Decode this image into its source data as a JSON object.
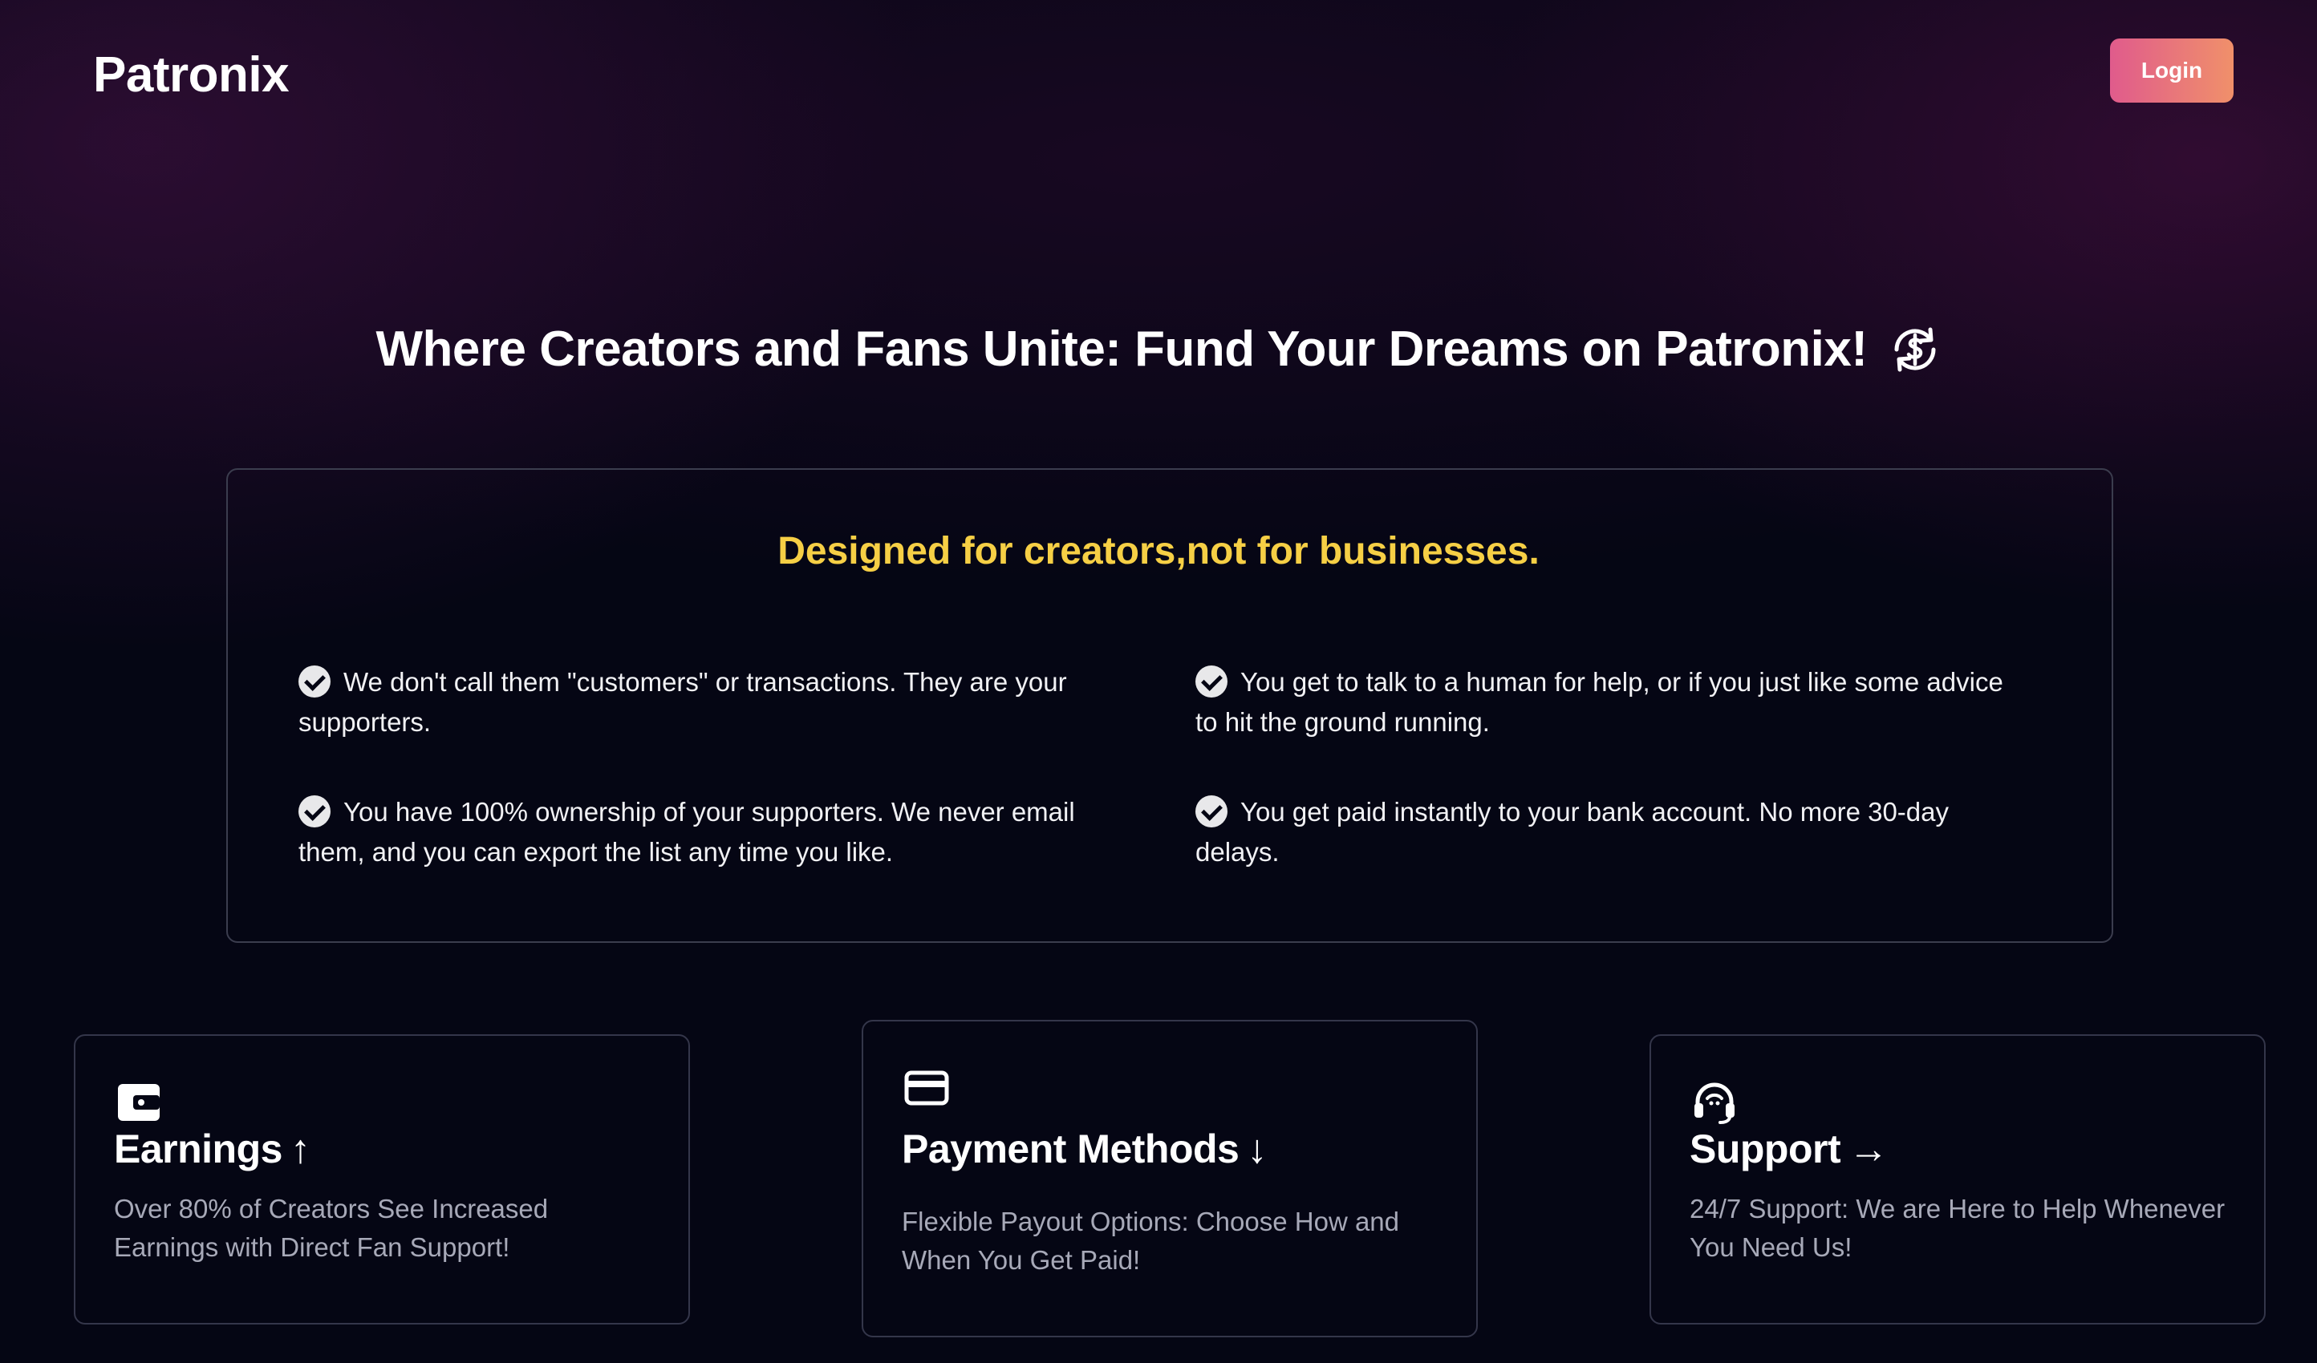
{
  "header": {
    "brand": "Patronix",
    "login_label": "Login"
  },
  "hero": {
    "title": "Where Creators and Fans Unite: Fund Your Dreams on Patronix!",
    "icon": "dollar-refresh-icon"
  },
  "features": {
    "title": "Designed for creators,not for businesses.",
    "accent_color": "#f6cf45",
    "points": [
      {
        "text": "We don't call them \"customers\" or transactions. They are your supporters."
      },
      {
        "text": "You get to talk to a human for help, or if you just like some advice to hit the ground running."
      },
      {
        "text": "You have 100% ownership of your supporters. We never email them, and you can export the list any time you like."
      },
      {
        "text": "You get paid instantly to your bank account. No more 30-day delays."
      }
    ]
  },
  "cards": [
    {
      "icon": "wallet-icon",
      "title": "Earnings",
      "arrow": "↑",
      "description": "Over 80% of Creators See Increased Earnings with Direct Fan Support!"
    },
    {
      "icon": "credit-card-icon",
      "title": "Payment Methods",
      "arrow": "↓",
      "description": "Flexible Payout Options: Choose How and When You Get Paid!"
    },
    {
      "icon": "headset-icon",
      "title": "Support",
      "arrow": "→",
      "description": "24/7 Support: We are Here to Help Whenever You Need Us!"
    }
  ],
  "colors": {
    "background": "#050614",
    "login_gradient_start": "#e05b8c",
    "login_gradient_end": "#f0906a"
  }
}
